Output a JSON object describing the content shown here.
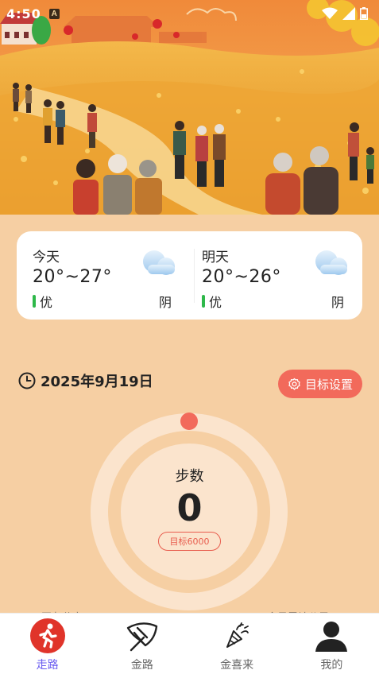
{
  "status_bar": {
    "time": "4:50"
  },
  "weather": {
    "today": {
      "day": "今天",
      "temp": "20°~27°",
      "quality": "优",
      "condition": "阴",
      "icon": "cloud-icon"
    },
    "tomorrow": {
      "day": "明天",
      "temp": "20°~26°",
      "quality": "优",
      "condition": "阴",
      "icon": "cloud-icon"
    },
    "quality_color": "#2eb84a"
  },
  "date": {
    "text": "2025年9月19日",
    "icon": "clock-icon"
  },
  "goal_button": {
    "label": "目标设置",
    "icon": "target-icon",
    "color": "#f26a5b"
  },
  "steps": {
    "label": "步数",
    "value": "0",
    "target_label": "目标6000",
    "progress": 0
  },
  "peek": {
    "left": "网友分享",
    "right": "今日累计公里"
  },
  "bottom_nav": {
    "items": [
      {
        "label": "走路",
        "icon": "walking-icon",
        "active": true
      },
      {
        "label": "金路",
        "icon": "ginkgo-leaf-icon",
        "active": false
      },
      {
        "label": "金喜来",
        "icon": "party-popper-icon",
        "active": false
      },
      {
        "label": "我的",
        "icon": "user-icon",
        "active": false
      }
    ],
    "active_color": "#6a5cf0"
  }
}
